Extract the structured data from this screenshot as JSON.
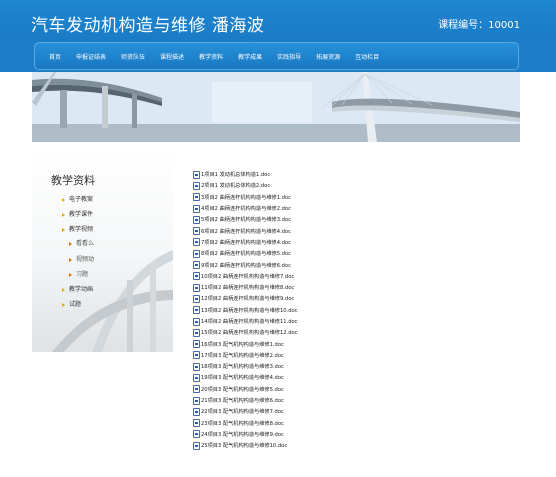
{
  "header": {
    "title": "汽车发动机构造与维修  潘海波",
    "course_no": "课程编号：10001"
  },
  "nav": {
    "items": [
      "首页",
      "申报证结表",
      "师资队伍",
      "课程描述",
      "教学资料",
      "教学成果",
      "实践指导",
      "拓展资源",
      "互动栏目"
    ]
  },
  "sidebar": {
    "title": "教学资料",
    "items": [
      {
        "label": "电子教案",
        "level": 1
      },
      {
        "label": "教学课件",
        "level": 1
      },
      {
        "label": "教学视频",
        "level": 1
      },
      {
        "label": "看看么",
        "level": 2
      },
      {
        "label": "视频动",
        "level": 2
      },
      {
        "label": "习题",
        "level": 2
      },
      {
        "label": "教学动画",
        "level": 1
      },
      {
        "label": "试题",
        "level": 1
      }
    ]
  },
  "files": [
    "1项目1 发动机总体构造1.doc",
    "2项目1 发动机总体构造2.doc",
    "3项目2 曲柄连杆机构构造与维修1.doc",
    "4项目2 曲柄连杆机构构造与维修2.doc",
    "5项目2 曲柄连杆机构构造与维修3.doc",
    "6项目2 曲柄连杆机构构造与维修4.doc",
    "7项目2 曲柄连杆机构构造与维修4.doc",
    "8项目2 曲柄连杆机构构造与维修5.doc",
    "9项目2 曲柄连杆机构构造与维修6.doc",
    "10项目2 曲柄连杆机构构造与维修7.doc",
    "11项目2 曲柄连杆机构构造与维修8.doc",
    "12项目2 曲柄连杆机构构造与维修9.doc",
    "13项目2 曲柄连杆机构构造与维修10.doc",
    "14项目2 曲柄连杆机构构造与维修11.doc",
    "15项目2 曲柄连杆机构构造与维修12.doc",
    "16项目3 配气机构构造与维修1.doc",
    "17项目3 配气机构构造与维修2.doc",
    "18项目3 配气机构构造与维修3.doc",
    "19项目3 配气机构构造与维修4.doc",
    "20项目3 配气机构构造与维修5.doc",
    "21项目3 配气机构构造与维修6.doc",
    "22项目3 配气机构构造与维修7.doc",
    "23项目3 配气机构构造与维修8.doc",
    "24项目3 配气机构构造与维修9.doc",
    "25项目3 配气机构构造与维修10.doc"
  ],
  "colors": {
    "header_bg": "#1f86d1",
    "nav_bg": "#1a78c2",
    "bullet": "#f0a400"
  }
}
